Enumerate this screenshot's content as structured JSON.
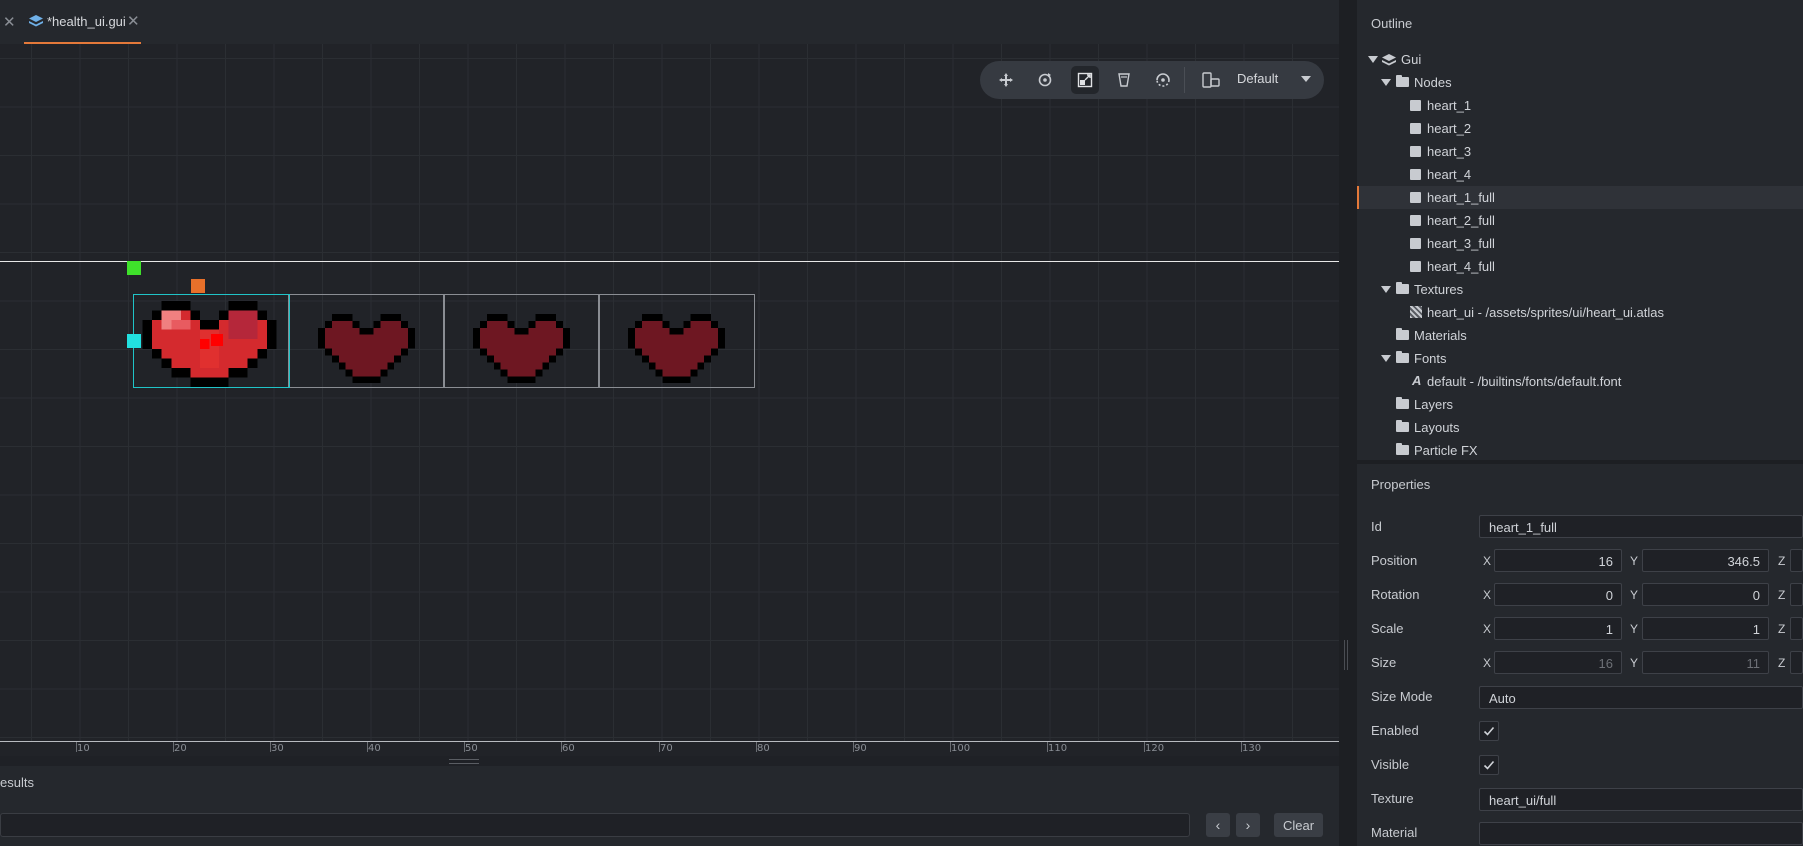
{
  "tabs": {
    "active_label": "*health_ui.gui"
  },
  "toolbar": {
    "tools": [
      "move-icon",
      "rotate-icon",
      "scale-icon",
      "resize-icon",
      "pivot-icon"
    ],
    "active_tool": "scale-icon",
    "layout": "Default"
  },
  "ruler": {
    "ticks": [
      "10",
      "20",
      "30",
      "40",
      "50",
      "60",
      "70",
      "80",
      "90",
      "100",
      "110",
      "120",
      "130"
    ]
  },
  "results": {
    "title": "esults",
    "clear_label": "Clear"
  },
  "outline": {
    "title": "Outline",
    "items": [
      {
        "label": "Gui"
      },
      {
        "label": "Nodes"
      },
      {
        "label": "heart_1"
      },
      {
        "label": "heart_2"
      },
      {
        "label": "heart_3"
      },
      {
        "label": "heart_4"
      },
      {
        "label": "heart_1_full"
      },
      {
        "label": "heart_2_full"
      },
      {
        "label": "heart_3_full"
      },
      {
        "label": "heart_4_full"
      },
      {
        "label": "Textures"
      },
      {
        "label": "heart_ui - /assets/sprites/ui/heart_ui.atlas"
      },
      {
        "label": "Materials"
      },
      {
        "label": "Fonts"
      },
      {
        "label": "default - /builtins/fonts/default.font"
      },
      {
        "label": "Layers"
      },
      {
        "label": "Layouts"
      },
      {
        "label": "Particle FX"
      }
    ],
    "selected": "heart_1_full"
  },
  "properties": {
    "title": "Properties",
    "id_label": "Id",
    "id_value": "heart_1_full",
    "position_label": "Position",
    "position": {
      "x": "16",
      "y": "346.5"
    },
    "rotation_label": "Rotation",
    "rotation": {
      "x": "0",
      "y": "0"
    },
    "scale_label": "Scale",
    "scale": {
      "x": "1",
      "y": "1"
    },
    "size_label": "Size",
    "size": {
      "x": "16",
      "y": "11"
    },
    "size_mode_label": "Size Mode",
    "size_mode": "Auto",
    "enabled_label": "Enabled",
    "enabled": true,
    "visible_label": "Visible",
    "visible": true,
    "texture_label": "Texture",
    "texture": "heart_ui/full",
    "material_label": "Material",
    "axis_x": "X",
    "axis_y": "Y",
    "axis_z": "Z"
  }
}
